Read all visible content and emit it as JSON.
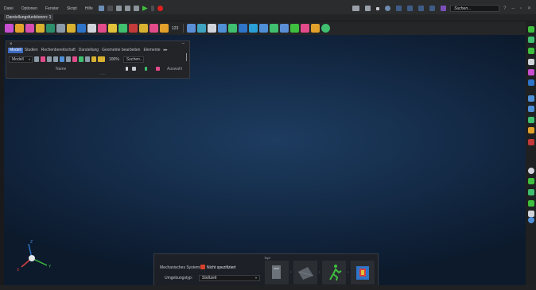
{
  "menu": {
    "items": [
      "Datei",
      "Optionen",
      "Fenster",
      "Skript",
      "Hilfe"
    ],
    "search_placeholder": "Suchen..."
  },
  "doc_tab": {
    "label": "Darstellungsfunktionen: 1"
  },
  "toolbar": {
    "counter": "123"
  },
  "ribbon": {
    "tabs": [
      "Modell",
      "Studien",
      "Rechenbereitschaft",
      "Darstellung",
      "Geometrie bearbeiten",
      "Elemente"
    ],
    "active_tab": "Modell",
    "model_select": "Modell",
    "zoom_percent": "100%",
    "search_placeholder": "Suchen...",
    "group_name": "Name",
    "group_auswahl": "Auswahl",
    "expand_glyph": "→←"
  },
  "triad": {
    "x": "X",
    "y": "Y",
    "z": "Z"
  },
  "bottom_panel": {
    "title": "Topf",
    "mech_label": "Mechanisches System:",
    "mech_value": "Nicht spezifiziert",
    "env_label": "Umgebungstyp:",
    "env_value": "Stoßzeit"
  },
  "colors": {
    "accent": "#3d6bc1",
    "play": "#3fbf3f",
    "record": "#e02020",
    "viewport_center": "#1d3c60",
    "viewport_edge": "#0c1a2c",
    "warning": "#d6402b"
  }
}
